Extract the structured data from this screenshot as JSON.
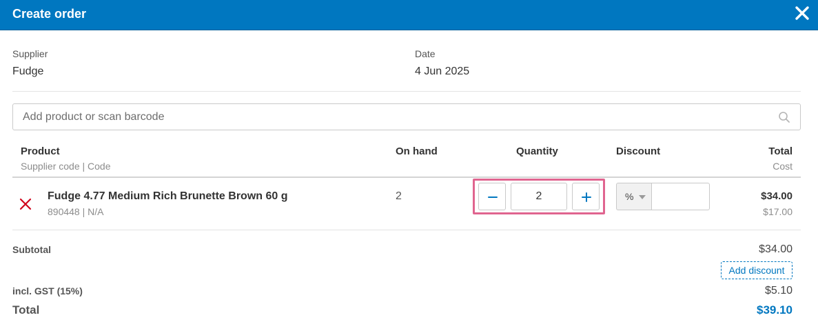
{
  "modal": {
    "title": "Create order",
    "close_icon": "close-icon"
  },
  "meta": {
    "supplier_label": "Supplier",
    "supplier_value": "Fudge",
    "date_label": "Date",
    "date_value": "4 Jun 2025"
  },
  "search": {
    "placeholder": "Add product or scan barcode",
    "icon": "search-icon"
  },
  "table": {
    "headers": {
      "product": "Product",
      "product_sub": "Supplier code | Code",
      "on_hand": "On hand",
      "quantity": "Quantity",
      "discount": "Discount",
      "total": "Total",
      "total_sub": "Cost"
    },
    "rows": [
      {
        "name": "Fudge 4.77 Medium Rich Brunette Brown 60 g",
        "codes": "890448 | N/A",
        "on_hand": "2",
        "quantity": "2",
        "discount_type": "%",
        "discount_value": "",
        "total": "$34.00",
        "cost": "$17.00"
      }
    ]
  },
  "summary": {
    "subtotal_label": "Subtotal",
    "subtotal_value": "$34.00",
    "add_discount_label": "Add discount",
    "gst_label": "incl. GST (15%)",
    "gst_value": "$5.10",
    "total_label": "Total",
    "total_value": "$39.10"
  },
  "colors": {
    "header": "#0077c0",
    "accent": "#0077c0",
    "remove": "#d0021b",
    "highlight": "#e0648f"
  }
}
